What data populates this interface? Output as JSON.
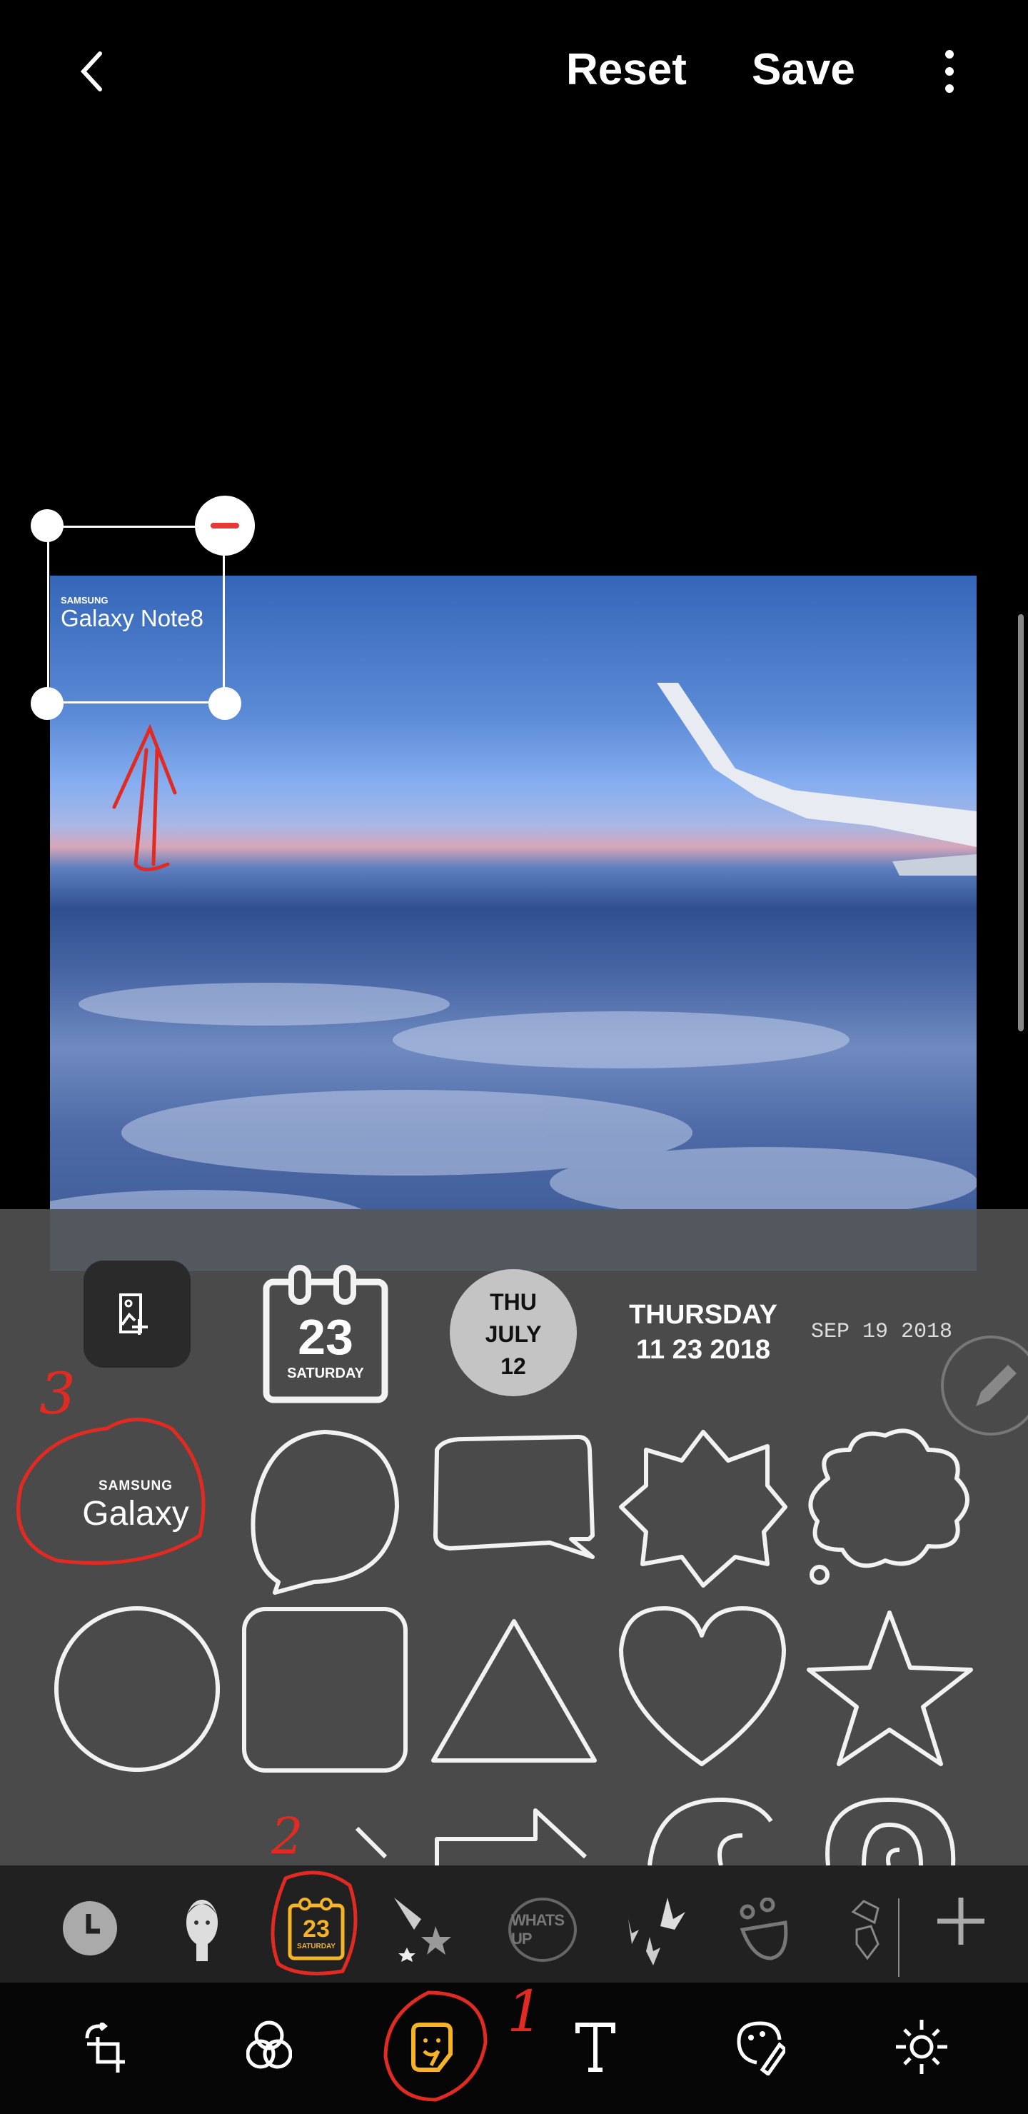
{
  "header": {
    "back_icon": "chevron-left-icon",
    "reset_label": "Reset",
    "save_label": "Save",
    "more_icon": "more-vertical-icon"
  },
  "canvas": {
    "watermark_brand": "SAMSUNG",
    "watermark_model": "Galaxy Note8",
    "remove_icon": "minus-circle-icon"
  },
  "stickers": {
    "add_image_icon": "image-add-icon",
    "calendar": {
      "day": "23",
      "weekday": "SATURDAY"
    },
    "circle_date": {
      "weekday": "THU",
      "month": "JULY",
      "day": "12"
    },
    "long_date": {
      "line1": "THURSDAY",
      "line2": "11 23 2018"
    },
    "mono_date": "SEP 19 2018",
    "galaxy": {
      "brand": "SAMSUNG",
      "model": "Galaxy"
    },
    "shapes": [
      "speech-bubble-round",
      "speech-bubble-rect",
      "burst",
      "thought-cloud",
      "circle",
      "rounded-square",
      "triangle",
      "heart",
      "star",
      "arrow",
      "spiral",
      "spiral-circle"
    ],
    "edit_icon": "pencil-icon"
  },
  "categories": [
    {
      "name": "recent",
      "icon": "clock-icon"
    },
    {
      "name": "avatar",
      "icon": "avatar-icon"
    },
    {
      "name": "date",
      "icon": "calendar-icon",
      "day": "23",
      "weekday": "SATURDAY",
      "selected": true,
      "color": "#f5b325"
    },
    {
      "name": "shooting-star",
      "icon": "shooting-star-icon"
    },
    {
      "name": "whats-up",
      "icon": "whats-up-icon",
      "text": "WHATS UP"
    },
    {
      "name": "leaves",
      "icon": "leaves-icon"
    },
    {
      "name": "face",
      "icon": "face-icon"
    },
    {
      "name": "gems",
      "icon": "gem-icon"
    },
    {
      "name": "add",
      "icon": "plus-icon"
    }
  ],
  "toolbar": [
    {
      "name": "transform",
      "icon": "crop-rotate-icon"
    },
    {
      "name": "filters",
      "icon": "filter-icon"
    },
    {
      "name": "stickers",
      "icon": "sticker-icon",
      "selected": true,
      "color": "#f5b325"
    },
    {
      "name": "text",
      "icon": "text-icon"
    },
    {
      "name": "draw",
      "icon": "palette-icon"
    },
    {
      "name": "adjust",
      "icon": "brightness-icon"
    }
  ],
  "annotations": {
    "step1": "1",
    "step2": "2",
    "step3": "3",
    "color": "#e02a22"
  }
}
